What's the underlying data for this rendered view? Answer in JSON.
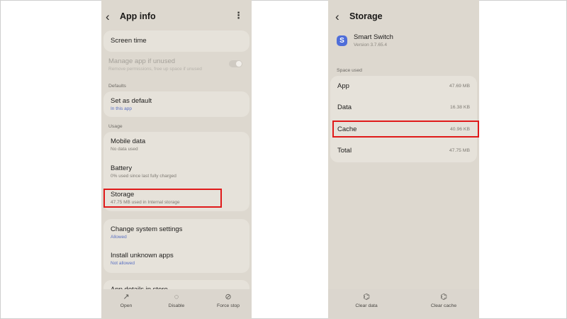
{
  "left": {
    "title": "App info",
    "items": {
      "screen_time": {
        "title": "Screen time"
      },
      "manage_unused": {
        "title": "Manage app if unused",
        "subtitle": "Remove permissions, free up space if unused"
      },
      "defaults_header": "Defaults",
      "set_default": {
        "title": "Set as default",
        "subtitle": "In this app"
      },
      "usage_header": "Usage",
      "mobile_data": {
        "title": "Mobile data",
        "subtitle": "No data used"
      },
      "battery": {
        "title": "Battery",
        "subtitle": "0% used since last fully charged"
      },
      "storage": {
        "title": "Storage",
        "subtitle": "47.75 MB used in Internal storage"
      },
      "change_settings": {
        "title": "Change system settings",
        "subtitle": "Allowed"
      },
      "install_unknown": {
        "title": "Install unknown apps",
        "subtitle": "Not allowed"
      },
      "app_details": {
        "title": "App details in store"
      }
    },
    "bottom": {
      "open": "Open",
      "disable": "Disable",
      "force_stop": "Force stop"
    }
  },
  "right": {
    "title": "Storage",
    "app": {
      "name": "Smart Switch",
      "version": "Version 3.7.65.4",
      "icon_letter": "S"
    },
    "space_used_header": "Space used",
    "rows": [
      {
        "label": "App",
        "value": "47.69 MB"
      },
      {
        "label": "Data",
        "value": "16.38 KB"
      },
      {
        "label": "Cache",
        "value": "40.96 KB"
      },
      {
        "label": "Total",
        "value": "47.75 MB"
      }
    ],
    "bottom": {
      "clear_data": "Clear data",
      "clear_cache": "Clear cache"
    }
  },
  "icons": {
    "back": "chevron-left-icon",
    "more": "more-vertical-icon",
    "open": "open-external-icon",
    "disable": "disable-icon",
    "force_stop": "force-stop-icon",
    "clear_data": "clear-data-icon",
    "clear_cache": "clear-cache-icon",
    "app_logo": "smart-switch-logo-icon"
  },
  "colors": {
    "highlight": "#e01a1a",
    "accent": "#4f6ed9",
    "screen_bg": "#ddd8cf",
    "card_bg": "#e6e2da"
  }
}
